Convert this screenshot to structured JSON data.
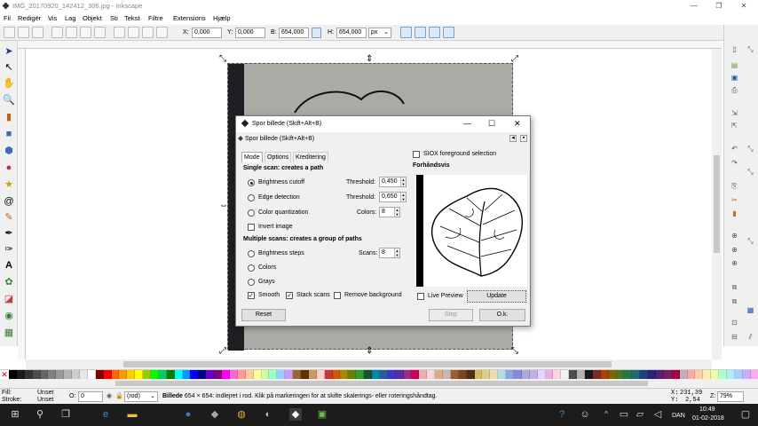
{
  "window": {
    "title": "IMG_20170920_142412_306.jpg - Inkscape",
    "minimize": "—",
    "maximize": "❐",
    "close": "✕"
  },
  "menu": [
    "Fil",
    "Redigér",
    "Vis",
    "Lag",
    "Objekt",
    "Sti",
    "Tekst",
    "Filtre",
    "Extensions",
    "Hjælp"
  ],
  "toolbar": {
    "x_label": "X:",
    "x_value": "0,000",
    "y_label": "Y:",
    "y_value": "0,000",
    "w_label": "B:",
    "w_value": "654,000",
    "h_label": "H:",
    "h_value": "654,000",
    "unit": "px"
  },
  "dialog": {
    "title": "Spor billede (Skift+Alt+B)",
    "panel_title": "Spor billede (Skift+Alt+B)",
    "minimize": "—",
    "maximize": "☐",
    "close": "✕",
    "tabs": [
      "Mode",
      "Options",
      "Kreditering"
    ],
    "single_header": "Single scan: creates a path",
    "brightness_cutoff": "Brightness cutoff",
    "edge_detection": "Edge detection",
    "color_quantization": "Color quantization",
    "invert_image": "Invert image",
    "threshold_label": "Threshold:",
    "threshold1": "0,450",
    "threshold2": "0,650",
    "colors_label": "Colors:",
    "colors_value": "8",
    "multi_header": "Multiple scans: creates a group of paths",
    "brightness_steps": "Brightness steps",
    "colors_opt": "Colors",
    "grays": "Grays",
    "scans_label": "Scans:",
    "scans_value": "8",
    "smooth": "Smooth",
    "stack_scans": "Stack scans",
    "remove_background": "Remove background",
    "siox": "SIOX foreground selection",
    "preview_title": "Forhåndsvis",
    "live_preview": "Live Preview",
    "update": "Update",
    "reset": "Reset",
    "stop": "Stop",
    "ok": "O.k."
  },
  "status": {
    "fill_label": "Fill:",
    "fill_value": "Unset",
    "stroke_label": "Stroke:",
    "stroke_value": "Unset",
    "opacity_label": "O:",
    "opacity_value": "0",
    "layer": "(rod)",
    "message_bold": "Billede",
    "message": " 654 × 654: indlejret i rod. Klik på markeringen for at skifte skalerings- eller roteringshåndtag.",
    "x_label": "X:",
    "x_value": "231,39",
    "y_label": "Y:",
    "y_value": "2,54",
    "z_label": "Z:",
    "zoom": "79%"
  },
  "taskbar": {
    "lang": "DAN",
    "time": "10:49",
    "date": "01-02-2018"
  },
  "palette_colors": [
    "#000000",
    "#1a1a1a",
    "#333333",
    "#4d4d4d",
    "#666666",
    "#808080",
    "#999999",
    "#b3b3b3",
    "#cccccc",
    "#e6e6e6",
    "#ffffff",
    "#800000",
    "#ff0000",
    "#ff6600",
    "#ff9900",
    "#ffcc00",
    "#ffff00",
    "#99cc00",
    "#00ff00",
    "#00cc66",
    "#008000",
    "#00ffff",
    "#0099ff",
    "#0000ff",
    "#000080",
    "#6600cc",
    "#800080",
    "#ff00ff",
    "#ff66cc",
    "#ff9999",
    "#ffcc99",
    "#ffff99",
    "#ccff99",
    "#99ffcc",
    "#99ccff",
    "#cc99ff",
    "#996633",
    "#663300",
    "#cc9966",
    "#ffcccc",
    "#c83737",
    "#d45500",
    "#aa8800",
    "#668000",
    "#2ca02c",
    "#16502d",
    "#0088aa",
    "#2c5aa0",
    "#3737c8",
    "#5a2ca0",
    "#a02c89",
    "#d40055",
    "#e9afaf",
    "#f4d7d7",
    "#deaa87",
    "#c8b7b7",
    "#a05a2c",
    "#784421",
    "#502d16",
    "#d3bc5f",
    "#decd87",
    "#e9ddaf",
    "#afdde9",
    "#87aade",
    "#8787de",
    "#aaaad4",
    "#c6afe9",
    "#e5d5ff",
    "#e9afdd",
    "#ffd5e5",
    "#f2f2f2",
    "#4d4d4d",
    "#b3b3b3",
    "#1a1a1a",
    "#7f2a2a",
    "#aa4400",
    "#806600",
    "#447821",
    "#217844",
    "#216778",
    "#214478",
    "#2b2178",
    "#552178",
    "#782167",
    "#aa0044",
    "#c8abb7",
    "#ffaaaa",
    "#ffccaa",
    "#ffeeaa",
    "#e5ffaa",
    "#aaffcc",
    "#aaeeff",
    "#aaccff",
    "#ccaaff",
    "#ffaaee"
  ]
}
